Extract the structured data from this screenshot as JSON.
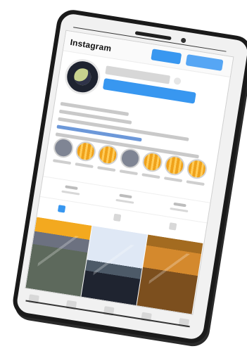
{
  "app": {
    "title": "Instagram",
    "buttons": {
      "primary": "",
      "secondary": ""
    }
  },
  "profile": {
    "avatar": "avatar",
    "username": "",
    "follow_button": ""
  },
  "bio": {
    "lines": [
      "",
      "",
      "",
      "",
      ""
    ]
  },
  "highlights": [
    {
      "style": "gray"
    },
    {
      "style": "orange"
    },
    {
      "style": "orange"
    },
    {
      "style": "gray"
    },
    {
      "style": "orange"
    },
    {
      "style": "orange"
    },
    {
      "style": "orange"
    }
  ],
  "stats": [
    {
      "label": ""
    },
    {
      "label": ""
    },
    {
      "label": ""
    }
  ],
  "views": [
    {
      "name": "grid"
    },
    {
      "name": "list"
    },
    {
      "name": "tag"
    }
  ],
  "nav": [
    {
      "name": "home"
    },
    {
      "name": "search"
    },
    {
      "name": "add"
    },
    {
      "name": "heart"
    },
    {
      "name": "profile"
    }
  ],
  "colors": {
    "accent": "#3897f0",
    "phone_frame": "#1a1a1a",
    "highlight_orange": "#f0a21a"
  }
}
